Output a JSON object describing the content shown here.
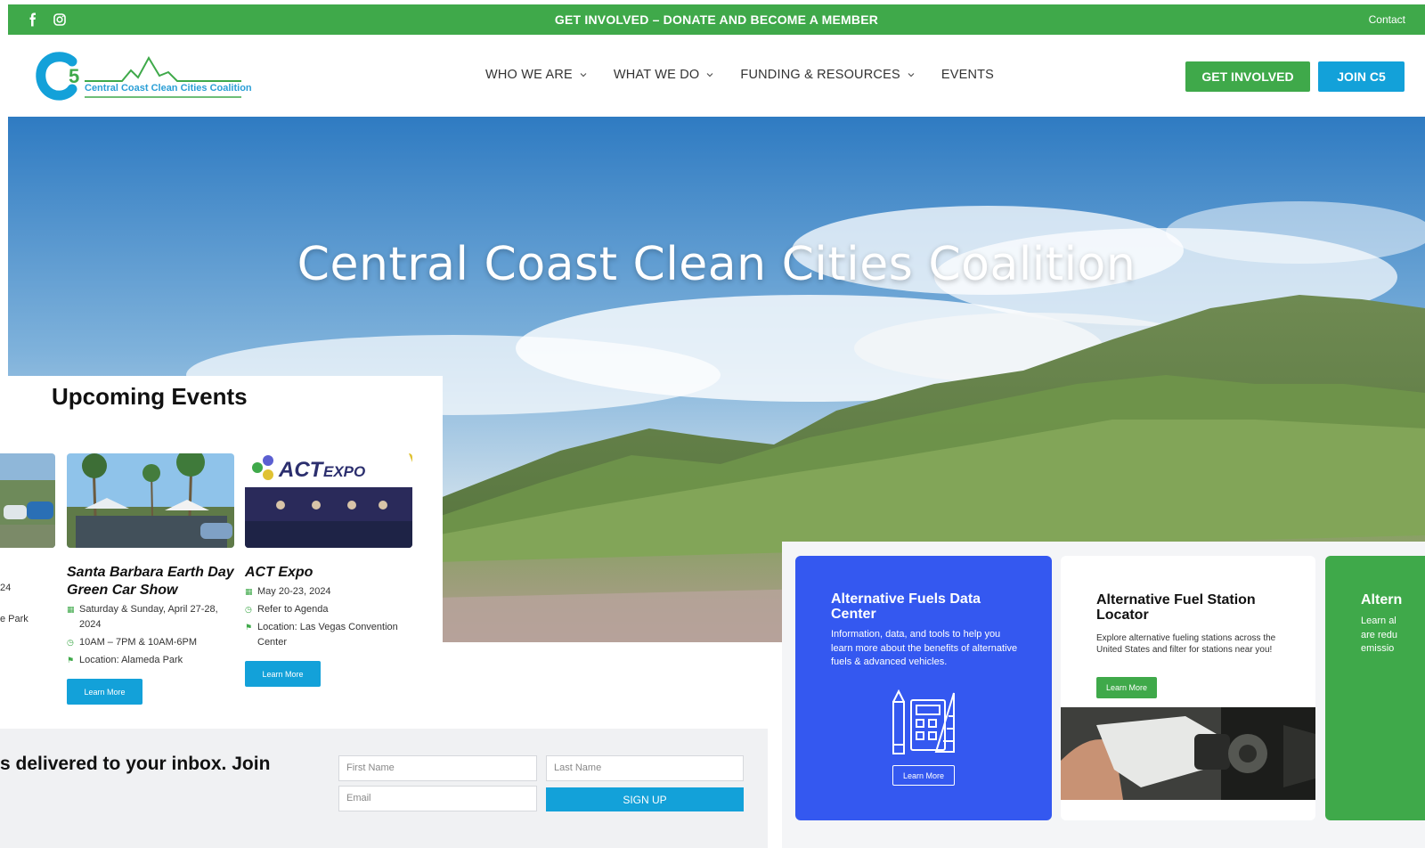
{
  "topbar": {
    "social_icons": [
      "facebook-icon",
      "instagram-icon"
    ],
    "banner": "GET INVOLVED – DONATE AND BECOME A MEMBER",
    "contact": "Contact",
    "background": "#3fa94a"
  },
  "header": {
    "logo_mark": "C5",
    "logo_text": "Central Coast Clean Cities Coalition",
    "nav": [
      {
        "label": "WHO WE ARE",
        "has_dropdown": true
      },
      {
        "label": "WHAT WE DO",
        "has_dropdown": true
      },
      {
        "label": "FUNDING & RESOURCES",
        "has_dropdown": true
      },
      {
        "label": "EVENTS",
        "has_dropdown": false
      }
    ],
    "get_involved": "GET INVOLVED",
    "join": "JOIN C5"
  },
  "hero": {
    "title": "Central Coast Clean Cities Coalition"
  },
  "events": {
    "title": "Upcoming Events",
    "cutoff_card": {
      "line1": "24",
      "line2": "e Park"
    },
    "cards": [
      {
        "name": "Santa Barbara Earth Day Green Car Show",
        "date": "Saturday & Sunday, April 27-28, 2024",
        "time": "10AM – 7PM & 10AM-6PM",
        "location": "Location: Alameda Park",
        "button": "Learn More"
      },
      {
        "name": "ACT Expo",
        "date": "May 20-23, 2024",
        "time": "Refer to Agenda",
        "location": "Location: Las Vegas Convention Center",
        "button": "Learn More",
        "image_logo": "ACTEXPO"
      }
    ]
  },
  "newsletter": {
    "text": "s delivered to your inbox. Join",
    "first_name_placeholder": "First Name",
    "last_name_placeholder": "Last Name",
    "email_placeholder": "Email",
    "button": "SIGN UP"
  },
  "features": [
    {
      "title": "Alternative Fuels Data Center",
      "description": "Information, data, and tools to help you learn more about the benefits of alternative fuels & advanced vehicles.",
      "button": "Learn More",
      "color": "#3458f0"
    },
    {
      "title": "Alternative Fuel Station Locator",
      "description": "Explore alternative fueling stations across the United States and filter for stations near you!",
      "button": "Learn More",
      "color": "#ffffff"
    },
    {
      "title": "Altern",
      "description_lines": [
        "Learn al",
        "are redu",
        "emissio"
      ],
      "color": "#3fa94a"
    }
  ]
}
